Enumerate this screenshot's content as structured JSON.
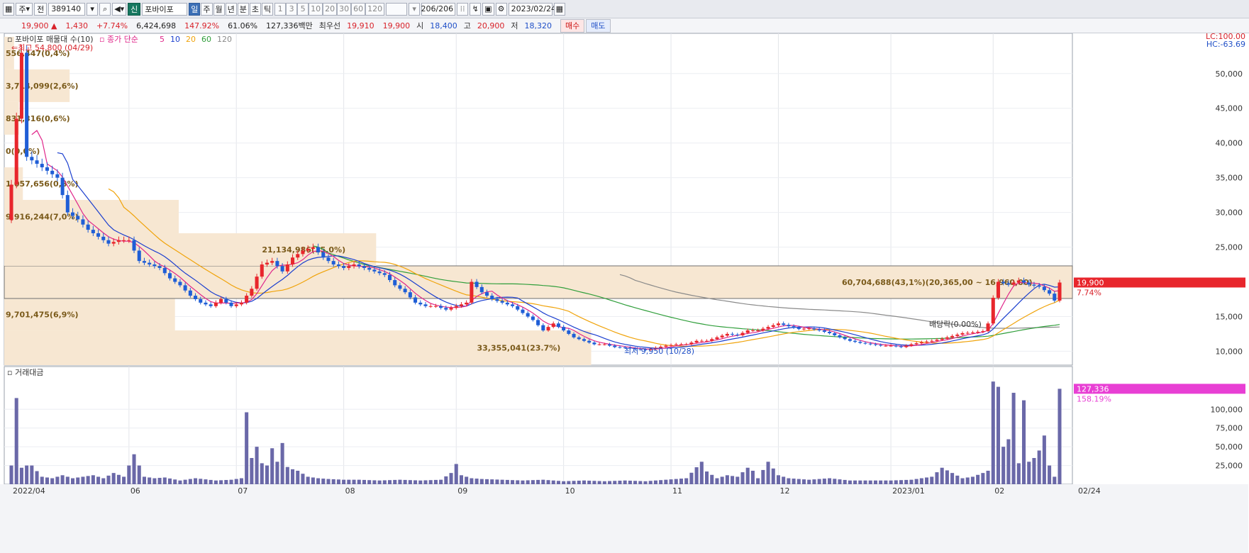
{
  "toolbar": {
    "period_unit": "주",
    "market": "전",
    "code": "389140",
    "name_badge": "신",
    "name": "포바이포",
    "tabs": [
      "일",
      "주",
      "월",
      "년",
      "분",
      "초",
      "틱"
    ],
    "active_tab": "일",
    "intervals": [
      "1",
      "3",
      "5",
      "10",
      "20",
      "30",
      "60",
      "120"
    ],
    "count": "206",
    "count_total": "/206",
    "date": "2023/02/24"
  },
  "quote": {
    "price": "19,900",
    "change": "1,430",
    "change_pct": "+7.74%",
    "volume": "6,424,698",
    "volume_ratio": "147.92%",
    "turnover": "61.06%",
    "trade_value": "127,336백만",
    "priority_ask_label": "최우선",
    "priority_ask": "19,910",
    "priority_bid": "19,900",
    "open_label": "시",
    "open": "18,400",
    "high_label": "고",
    "high": "20,900",
    "low_label": "저",
    "low": "18,320",
    "buy_label": "매수",
    "sell_label": "매도"
  },
  "colors": {
    "up": "#e8262c",
    "down": "#1f5ed6",
    "ma5": "#e0268a",
    "ma10": "#1b3fcf",
    "ma20": "#f0a30a",
    "ma60": "#2f9e3a",
    "ma120": "#8a8a8a",
    "volume_bar": "#6a68a8",
    "profile_fill": "#f7e7d2"
  },
  "chart_data": {
    "type": "candlestick",
    "price_panel": {
      "legend_title": "포바이포 매물대 수(10)",
      "ma_legend": {
        "label": "종가 단순",
        "periods": [
          "5",
          "10",
          "20",
          "60",
          "120"
        ]
      },
      "lc_label": "LC:100.00",
      "hc_label": "HC:-63.69",
      "y_ticks": [
        "50,000",
        "45,000",
        "40,000",
        "35,000",
        "30,000",
        "25,000",
        "20,000",
        "15,000",
        "10,000"
      ],
      "y_tick_values": [
        50000,
        45000,
        40000,
        35000,
        30000,
        25000,
        20000,
        15000,
        10000
      ],
      "ylim": [
        8000,
        55800
      ],
      "last_price_tag": "19,900",
      "last_pct_tag": "7.74%",
      "high_annotation": "최고 54,800 (04/29)",
      "low_annotation": "최저 9,950 (10/28)",
      "dividend_annotation": "배당락(0.00%)",
      "x_labels": [
        "2022/04",
        "06",
        "07",
        "08",
        "09",
        "10",
        "11",
        "12",
        "2023/01",
        "02",
        "02/24"
      ],
      "x_label_index": [
        0,
        23,
        44,
        65,
        87,
        108,
        129,
        150,
        172,
        192,
        205
      ],
      "volume_profile": [
        {
          "low": 8000,
          "high": 13000,
          "value": 33355041,
          "label": "33,355,041(23.7%)"
        },
        {
          "low": 13000,
          "high": 17600,
          "value": 9701475,
          "label": "9,701,475(6,9%)"
        },
        {
          "low": 17600,
          "high": 22300,
          "value": 60704688,
          "label": "60,704,688(43,1%)(20,365,00 ~ 16,960,00)"
        },
        {
          "low": 22300,
          "high": 27000,
          "value": 21134986,
          "label": "21,134,986(15,0%)"
        },
        {
          "low": 27000,
          "high": 31800,
          "value": 9916244,
          "label": "9,916,244(7,0%)"
        },
        {
          "low": 31800,
          "high": 36500,
          "value": 1057656,
          "label": "1,057,656(0,8%)"
        },
        {
          "low": 36500,
          "high": 41200,
          "value": 0,
          "label": "0(0,0%)"
        },
        {
          "low": 41200,
          "high": 45900,
          "value": 831316,
          "label": "831,316(0,6%)"
        },
        {
          "low": 45900,
          "high": 50600,
          "value": 3714099,
          "label": "3,714,099(2,6%)"
        },
        {
          "low": 50600,
          "high": 55300,
          "value": 556447,
          "label": "556,447(0,4%)"
        }
      ]
    },
    "volume_panel": {
      "title": "거래대금",
      "y_ticks": [
        "100,000",
        "75,000",
        "50,000",
        "25,000"
      ],
      "y_tick_values": [
        100000,
        75000,
        50000,
        25000
      ],
      "ylim": [
        0,
        140000
      ],
      "last_value_tag": "127,336",
      "last_pct_tag": "158.19%"
    },
    "close_path": [
      [
        0,
        34000
      ],
      [
        2,
        53000
      ],
      [
        3,
        38000
      ],
      [
        5,
        37000
      ],
      [
        7,
        36000
      ],
      [
        9,
        35000
      ],
      [
        11,
        30000
      ],
      [
        13,
        29000
      ],
      [
        15,
        27500
      ],
      [
        17,
        26500
      ],
      [
        19,
        25500
      ],
      [
        21,
        26000
      ],
      [
        23,
        26000
      ],
      [
        25,
        23000
      ],
      [
        27,
        22500
      ],
      [
        29,
        22000
      ],
      [
        31,
        20500
      ],
      [
        33,
        19500
      ],
      [
        35,
        18000
      ],
      [
        37,
        17000
      ],
      [
        39,
        16500
      ],
      [
        41,
        17500
      ],
      [
        43,
        16500
      ],
      [
        45,
        17000
      ],
      [
        47,
        19000
      ],
      [
        49,
        22500
      ],
      [
        51,
        23000
      ],
      [
        53,
        21500
      ],
      [
        55,
        23500
      ],
      [
        57,
        24500
      ],
      [
        59,
        25000
      ],
      [
        61,
        23500
      ],
      [
        63,
        22500
      ],
      [
        65,
        22000
      ],
      [
        67,
        22500
      ],
      [
        69,
        22000
      ],
      [
        71,
        21500
      ],
      [
        73,
        21000
      ],
      [
        75,
        19500
      ],
      [
        77,
        18500
      ],
      [
        79,
        17000
      ],
      [
        81,
        16500
      ],
      [
        83,
        16500
      ],
      [
        85,
        16000
      ],
      [
        87,
        16500
      ],
      [
        89,
        17000
      ],
      [
        90,
        20000
      ],
      [
        92,
        18500
      ],
      [
        94,
        17500
      ],
      [
        96,
        17000
      ],
      [
        98,
        16500
      ],
      [
        100,
        15500
      ],
      [
        102,
        14500
      ],
      [
        104,
        13000
      ],
      [
        106,
        14000
      ],
      [
        108,
        13000
      ],
      [
        110,
        12000
      ],
      [
        112,
        11500
      ],
      [
        114,
        11000
      ],
      [
        116,
        11000
      ],
      [
        118,
        10600
      ],
      [
        120,
        10500
      ],
      [
        122,
        10300
      ],
      [
        124,
        10200
      ],
      [
        126,
        10500
      ],
      [
        128,
        10800
      ],
      [
        130,
        11000
      ],
      [
        132,
        11000
      ],
      [
        134,
        11500
      ],
      [
        136,
        11500
      ],
      [
        138,
        12000
      ],
      [
        140,
        12500
      ],
      [
        142,
        12300
      ],
      [
        144,
        13000
      ],
      [
        146,
        13000
      ],
      [
        148,
        13500
      ],
      [
        150,
        14000
      ],
      [
        152,
        13600
      ],
      [
        154,
        13200
      ],
      [
        156,
        13300
      ],
      [
        158,
        13000
      ],
      [
        160,
        12600
      ],
      [
        162,
        12000
      ],
      [
        164,
        11500
      ],
      [
        166,
        11200
      ],
      [
        168,
        11000
      ],
      [
        170,
        10800
      ],
      [
        172,
        10800
      ],
      [
        174,
        10600
      ],
      [
        176,
        11000
      ],
      [
        178,
        11300
      ],
      [
        180,
        11500
      ],
      [
        182,
        11800
      ],
      [
        184,
        12200
      ],
      [
        186,
        12600
      ],
      [
        188,
        12700
      ],
      [
        190,
        12900
      ],
      [
        191,
        14000
      ],
      [
        192,
        17700
      ],
      [
        193,
        20000
      ],
      [
        195,
        19600
      ],
      [
        197,
        20200
      ],
      [
        199,
        19600
      ],
      [
        201,
        19300
      ],
      [
        203,
        18300
      ],
      [
        204,
        17300
      ],
      [
        205,
        19900
      ]
    ],
    "ma_windows": {
      "ma5": 5,
      "ma10": 10,
      "ma20": 20,
      "ma60": 60,
      "ma120": 120
    },
    "volume_path": [
      [
        0,
        25000
      ],
      [
        1,
        115000
      ],
      [
        2,
        22000
      ],
      [
        3,
        25000
      ],
      [
        4,
        25000
      ],
      [
        6,
        10000
      ],
      [
        8,
        8000
      ],
      [
        10,
        12000
      ],
      [
        12,
        8000
      ],
      [
        14,
        10000
      ],
      [
        16,
        12000
      ],
      [
        18,
        8000
      ],
      [
        20,
        15000
      ],
      [
        22,
        10000
      ],
      [
        24,
        40000
      ],
      [
        26,
        10000
      ],
      [
        28,
        8000
      ],
      [
        30,
        9000
      ],
      [
        33,
        5000
      ],
      [
        36,
        8000
      ],
      [
        40,
        5000
      ],
      [
        43,
        6000
      ],
      [
        45,
        8000
      ],
      [
        46,
        96000
      ],
      [
        47,
        35000
      ],
      [
        48,
        50000
      ],
      [
        49,
        28000
      ],
      [
        50,
        25000
      ],
      [
        51,
        48000
      ],
      [
        52,
        30000
      ],
      [
        53,
        55000
      ],
      [
        54,
        23000
      ],
      [
        55,
        20000
      ],
      [
        56,
        18000
      ],
      [
        58,
        10000
      ],
      [
        60,
        8000
      ],
      [
        62,
        7000
      ],
      [
        65,
        6000
      ],
      [
        68,
        6000
      ],
      [
        72,
        5000
      ],
      [
        76,
        6000
      ],
      [
        80,
        5000
      ],
      [
        84,
        6000
      ],
      [
        86,
        15000
      ],
      [
        87,
        27000
      ],
      [
        88,
        12000
      ],
      [
        90,
        8000
      ],
      [
        92,
        7000
      ],
      [
        96,
        6000
      ],
      [
        100,
        5000
      ],
      [
        104,
        6000
      ],
      [
        108,
        4000
      ],
      [
        112,
        5000
      ],
      [
        116,
        4000
      ],
      [
        120,
        5000
      ],
      [
        124,
        4000
      ],
      [
        128,
        6000
      ],
      [
        132,
        8000
      ],
      [
        135,
        30000
      ],
      [
        136,
        17000
      ],
      [
        138,
        8000
      ],
      [
        140,
        12000
      ],
      [
        142,
        10000
      ],
      [
        144,
        22000
      ],
      [
        145,
        18000
      ],
      [
        146,
        8000
      ],
      [
        148,
        30000
      ],
      [
        150,
        12000
      ],
      [
        152,
        8000
      ],
      [
        156,
        6000
      ],
      [
        160,
        8000
      ],
      [
        164,
        5000
      ],
      [
        168,
        5000
      ],
      [
        172,
        5000
      ],
      [
        176,
        6000
      ],
      [
        180,
        10000
      ],
      [
        182,
        22000
      ],
      [
        184,
        15000
      ],
      [
        186,
        8000
      ],
      [
        188,
        10000
      ],
      [
        190,
        15000
      ],
      [
        191,
        18000
      ],
      [
        192,
        137000
      ],
      [
        193,
        130000
      ],
      [
        194,
        50000
      ],
      [
        195,
        60000
      ],
      [
        196,
        122000
      ],
      [
        197,
        28000
      ],
      [
        198,
        112000
      ],
      [
        199,
        30000
      ],
      [
        200,
        35000
      ],
      [
        201,
        45000
      ],
      [
        202,
        65000
      ],
      [
        203,
        25000
      ],
      [
        204,
        10000
      ],
      [
        205,
        127336
      ]
    ],
    "n_bars": 206
  }
}
